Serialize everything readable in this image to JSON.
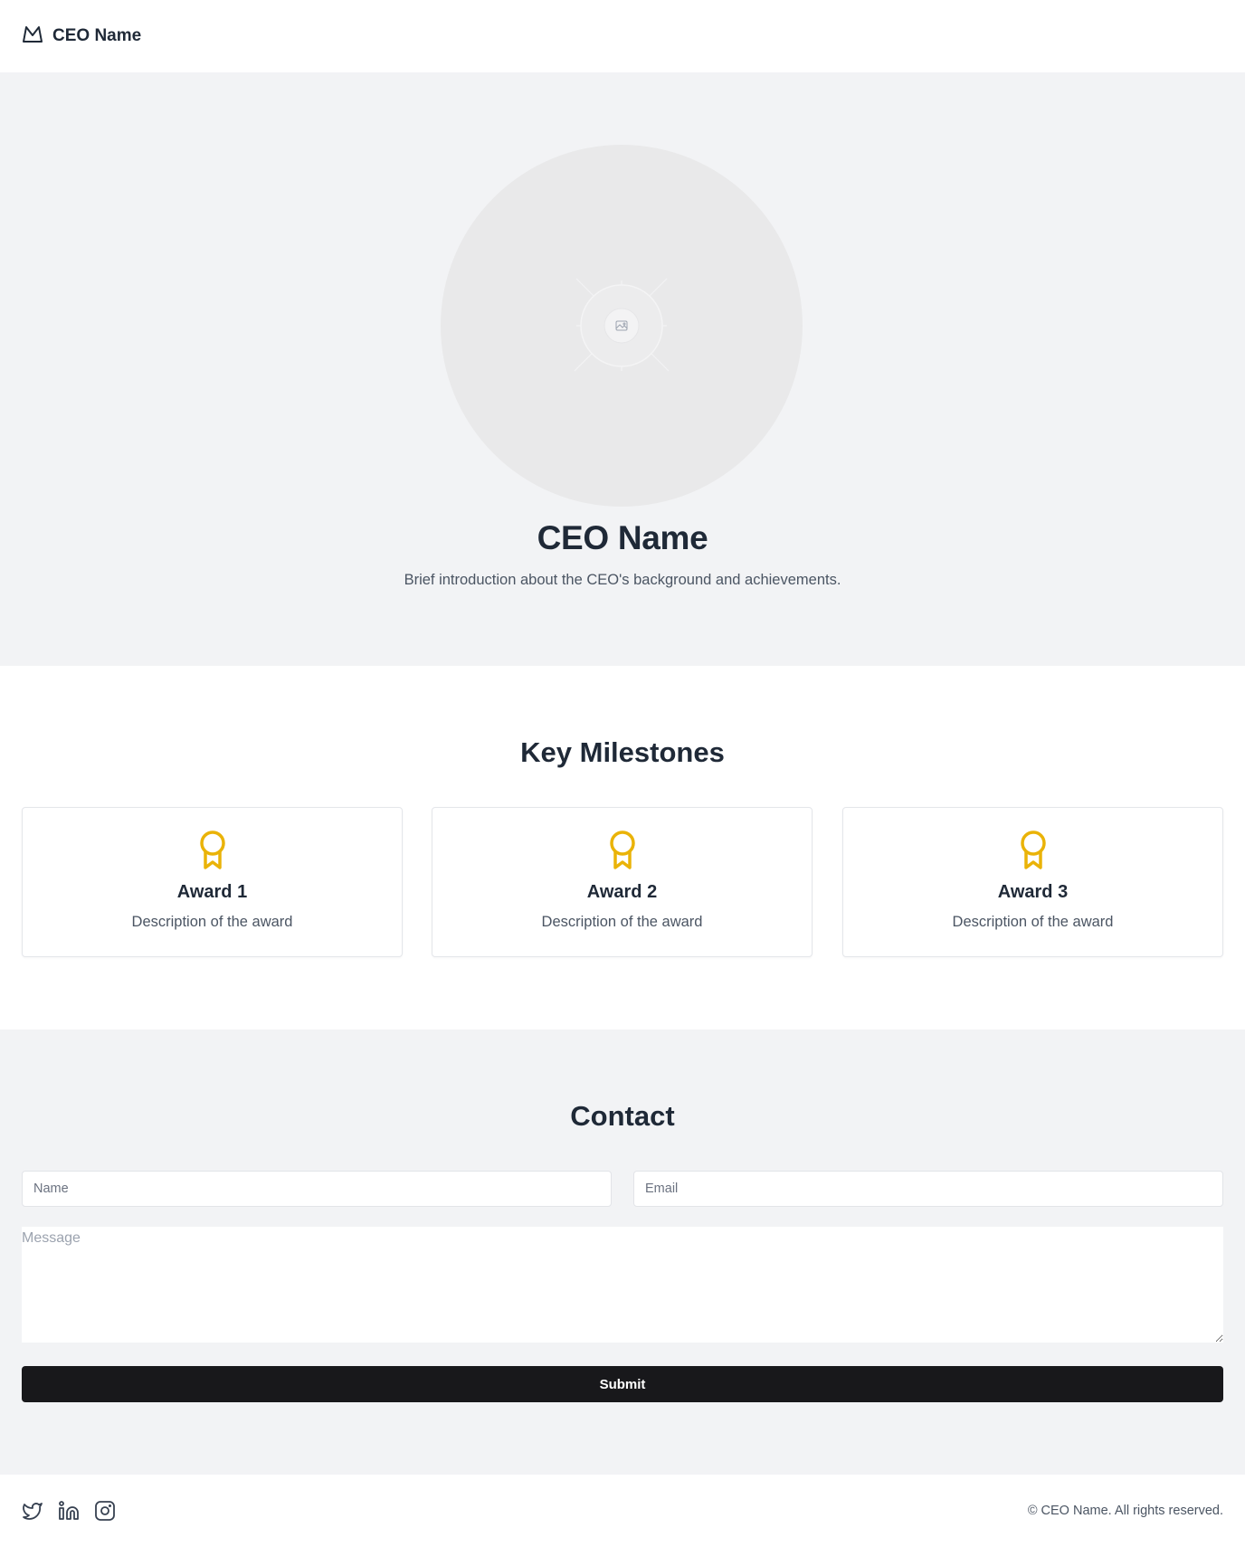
{
  "header": {
    "brand_icon": "crown-icon",
    "brand_name": "CEO Name"
  },
  "hero": {
    "portrait_icon": "image-placeholder-icon",
    "title": "CEO Name",
    "intro": "Brief introduction about the CEO's background and achievements."
  },
  "milestones": {
    "title": "Key Milestones",
    "items": [
      {
        "icon": "award-icon",
        "title": "Award 1",
        "description": "Description of the award"
      },
      {
        "icon": "award-icon",
        "title": "Award 2",
        "description": "Description of the award"
      },
      {
        "icon": "award-icon",
        "title": "Award 3",
        "description": "Description of the award"
      }
    ]
  },
  "contact": {
    "title": "Contact",
    "name_placeholder": "Name",
    "email_placeholder": "Email",
    "message_placeholder": "Message",
    "submit_label": "Submit"
  },
  "footer": {
    "socials": [
      "twitter-icon",
      "linkedin-icon",
      "instagram-icon"
    ],
    "copyright": "© CEO Name. All rights reserved."
  },
  "colors": {
    "accent_award": "#eab308",
    "section_bg": "#f2f3f5",
    "button_bg": "#18181b",
    "heading": "#1f2937",
    "body_text": "#4b5563"
  }
}
